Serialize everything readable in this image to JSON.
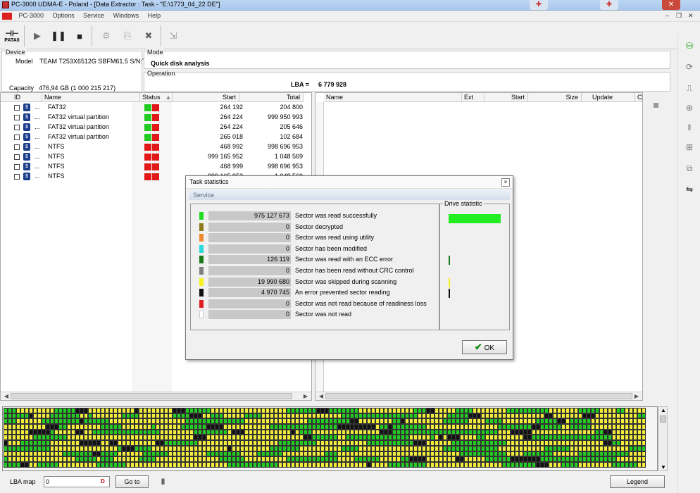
{
  "window": {
    "title": "PC-3000 UDMA-E - Poland - [Data Extractor : Task - \"E:\\1773_04_22 DE\"]"
  },
  "menu": [
    "PC-3000",
    "Options",
    "Service",
    "Windows",
    "Help"
  ],
  "toolbar": {
    "pata_label": "PATA0"
  },
  "device": {
    "group_label": "Device",
    "model_label": "Model",
    "model_value": "TEAM T253X6512G SBFM61.5 S/N:T",
    "capacity_label": "Capacity",
    "capacity_value": "476,94 GB (1 000 215 217)"
  },
  "mode": {
    "group_label": "Mode",
    "value": "Quick disk  analysis"
  },
  "operation": {
    "group_label": "Operation",
    "lba_label": "LBA =",
    "lba_value": "6 779 928"
  },
  "left_table": {
    "headers": {
      "id": "ID",
      "name": "Name",
      "status": "Status",
      "start": "Start",
      "total": "Total"
    },
    "rows": [
      {
        "dots": "...",
        "name": "FAT32",
        "s1": "#22cc22",
        "s2": "#e01818",
        "start": "264 192",
        "total": "204 800"
      },
      {
        "dots": "...",
        "name": "FAT32 virtual partition",
        "s1": "#22cc22",
        "s2": "#e01818",
        "start": "264 224",
        "total": "999 950 993"
      },
      {
        "dots": "...",
        "name": "FAT32 virtual partition",
        "s1": "#22cc22",
        "s2": "#e01818",
        "start": "264 224",
        "total": "205 646"
      },
      {
        "dots": "...",
        "name": "FAT32 virtual partition",
        "s1": "#22cc22",
        "s2": "#e01818",
        "start": "265 018",
        "total": "102 684"
      },
      {
        "dots": "...",
        "name": "NTFS",
        "s1": "#e01818",
        "s2": "#e01818",
        "start": "468 992",
        "total": "998 696 953"
      },
      {
        "dots": "...",
        "name": "NTFS",
        "s1": "#e01818",
        "s2": "#e01818",
        "start": "999 165 952",
        "total": "1 048 569"
      },
      {
        "dots": "...",
        "name": "NTFS",
        "s1": "#e01818",
        "s2": "#e01818",
        "start": "468 999",
        "total": "998 696 953"
      },
      {
        "dots": "...",
        "name": "NTFS",
        "s1": "#e01818",
        "s2": "#e01818",
        "start": "999 165 952",
        "total": "1 048 569"
      }
    ]
  },
  "right_table": {
    "headers": {
      "name": "Name",
      "ext": "Ext",
      "start": "Start",
      "size": "Size",
      "update": "Update",
      "c": "C"
    }
  },
  "dialog": {
    "title": "Task statistics",
    "close": "×",
    "service_label": "Service",
    "drive_statistic_label": "Drive statistic",
    "ok_label": "OK",
    "rows": [
      {
        "color": "#22dd22",
        "value": "975 127 673",
        "label": "Sector was read successfully"
      },
      {
        "color": "#8a7a1a",
        "value": "0",
        "label": "Sector decrypted"
      },
      {
        "color": "#f08a2a",
        "value": "0",
        "label": "Sector was read using utility"
      },
      {
        "color": "#2adada",
        "value": "0",
        "label": "Sector has been modified"
      },
      {
        "color": "#1a7a1a",
        "value": "126 119",
        "label": "Sector was read with an ECC error"
      },
      {
        "color": "#808080",
        "value": "0",
        "label": "Sector has been read without CRC control"
      },
      {
        "color": "#f8f020",
        "value": "19 990 680",
        "label": "Sector was skipped during scanning"
      },
      {
        "color": "#111111",
        "value": "4 970 745",
        "label": "An error prevented sector reading"
      },
      {
        "color": "#e02020",
        "value": "0",
        "label": "Sector was not read because of readiness loss"
      },
      {
        "color": "#ffffff",
        "value": "0",
        "label": "Sector was not read"
      }
    ],
    "drive_bars": [
      {
        "color": "#22ee22",
        "fraction": 0.9752
      },
      {
        "color": "#1a7a1a",
        "fraction": 0.0013
      },
      {
        "color": "#f8f020",
        "fraction": 0.02
      },
      {
        "color": "#111111",
        "fraction": 0.005
      }
    ]
  },
  "bottom": {
    "lba_map_label": "LBA map",
    "lba_input_value": "0",
    "goto_label": "Go to",
    "pause_label": "||",
    "legend_label": "Legend"
  }
}
